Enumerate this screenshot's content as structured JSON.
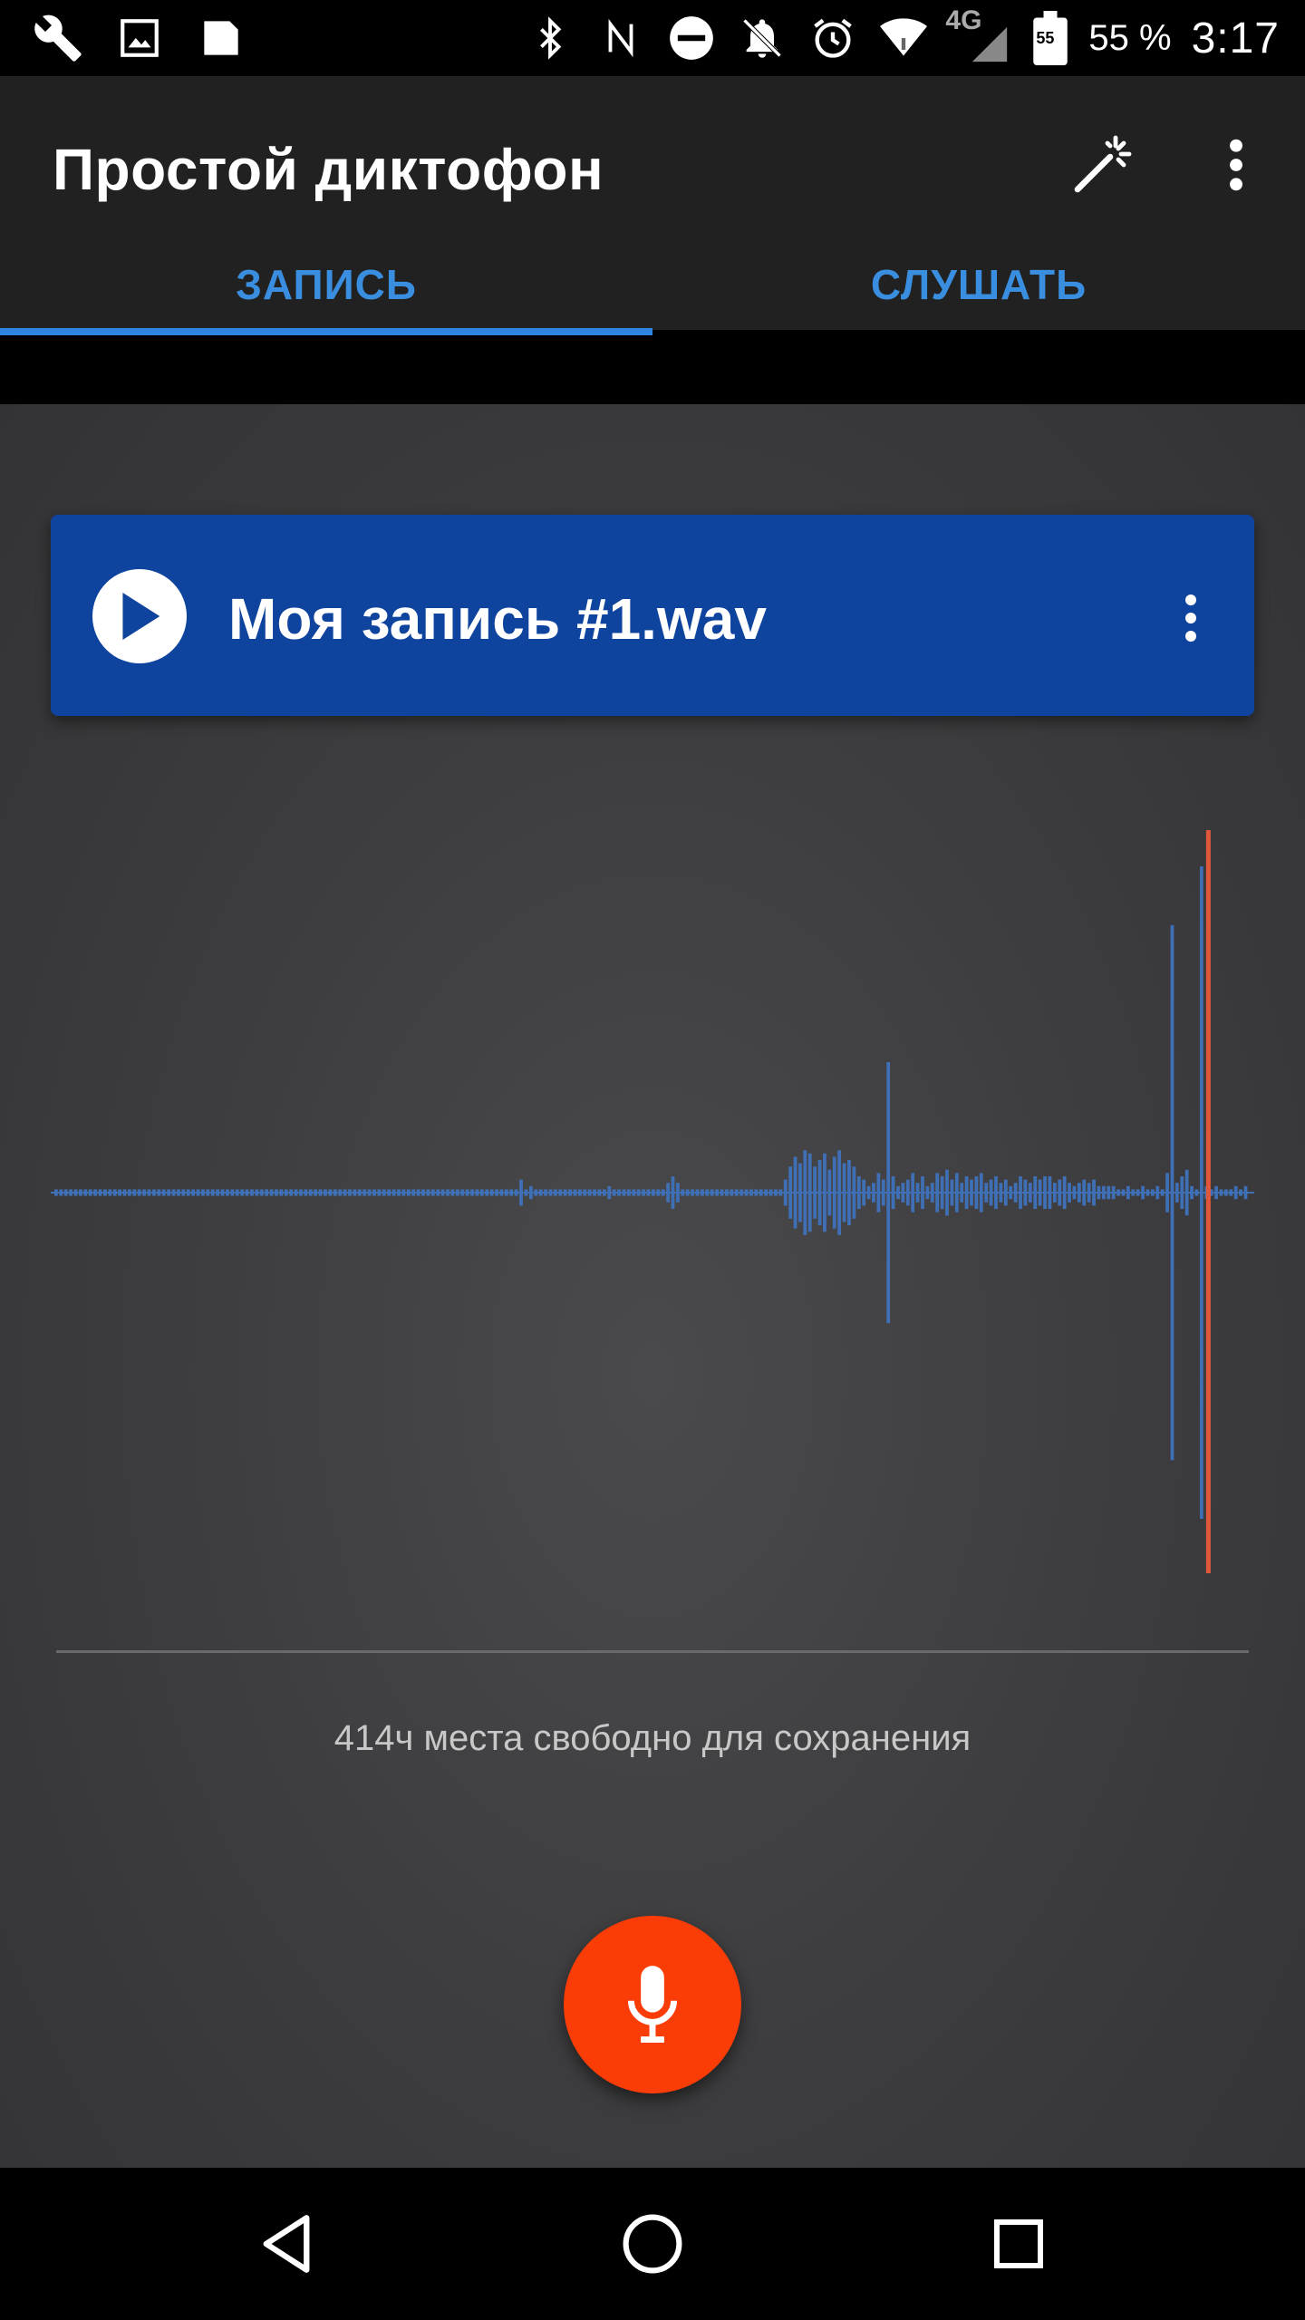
{
  "status_bar": {
    "battery_icon_text": "55",
    "battery_percent": "55 %",
    "network": "4G",
    "time": "3:17",
    "icons_left": [
      "wrench-icon",
      "image-icon",
      "sd-card-icon"
    ],
    "icons_right": [
      "bluetooth-icon",
      "nfc-icon",
      "do-not-disturb-icon",
      "notifications-off-icon",
      "alarm-icon",
      "wifi-icon",
      "signal-icon",
      "battery-icon"
    ]
  },
  "app_bar": {
    "title": "Простой диктофон",
    "actions": [
      "magic-wand-icon",
      "more-vert-icon"
    ]
  },
  "tabs": [
    {
      "label": "ЗАПИСЬ",
      "selected": true
    },
    {
      "label": "СЛУШАТЬ",
      "selected": false
    }
  ],
  "recording": {
    "file_name": "Моя запись #1.wav"
  },
  "storage": {
    "free_text": "414ч места свободно для сохранения"
  },
  "waveform": {
    "amplitudes": [
      0.01,
      0.01,
      0.01,
      0.01,
      0.01,
      0.01,
      0.01,
      0.01,
      0.01,
      0.01,
      0.01,
      0.01,
      0.01,
      0.01,
      0.01,
      0.01,
      0.01,
      0.01,
      0.01,
      0.01,
      0.01,
      0.01,
      0.01,
      0.01,
      0.01,
      0.01,
      0.01,
      0.01,
      0.01,
      0.01,
      0.01,
      0.01,
      0.01,
      0.01,
      0.01,
      0.01,
      0.01,
      0.01,
      0.01,
      0.01,
      0.01,
      0.01,
      0.01,
      0.01,
      0.01,
      0.01,
      0.01,
      0.01,
      0.01,
      0.01,
      0.01,
      0.01,
      0.01,
      0.01,
      0.01,
      0.01,
      0.01,
      0.01,
      0.01,
      0.01,
      0.01,
      0.01,
      0.01,
      0.01,
      0.01,
      0.01,
      0.01,
      0.01,
      0.01,
      0.01,
      0.01,
      0.01,
      0.01,
      0.01,
      0.01,
      0.01,
      0.01,
      0.01,
      0.01,
      0.01,
      0.01,
      0.01,
      0.01,
      0.01,
      0.01,
      0.01,
      0.01,
      0.01,
      0.01,
      0.01,
      0.01,
      0.01,
      0.01,
      0.01,
      0.01,
      0.04,
      0.01,
      0.02,
      0.01,
      0.01,
      0.01,
      0.01,
      0.01,
      0.01,
      0.01,
      0.01,
      0.01,
      0.01,
      0.01,
      0.01,
      0.01,
      0.01,
      0.01,
      0.02,
      0.01,
      0.01,
      0.01,
      0.01,
      0.01,
      0.01,
      0.01,
      0.01,
      0.01,
      0.01,
      0.01,
      0.03,
      0.05,
      0.03,
      0.01,
      0.01,
      0.01,
      0.01,
      0.01,
      0.01,
      0.01,
      0.01,
      0.01,
      0.01,
      0.01,
      0.01,
      0.01,
      0.01,
      0.01,
      0.01,
      0.01,
      0.01,
      0.01,
      0.01,
      0.01,
      0.04,
      0.08,
      0.11,
      0.09,
      0.13,
      0.12,
      0.08,
      0.1,
      0.12,
      0.07,
      0.11,
      0.13,
      0.09,
      0.1,
      0.08,
      0.05,
      0.04,
      0.02,
      0.03,
      0.06,
      0.04,
      0.4,
      0.05,
      0.02,
      0.03,
      0.04,
      0.06,
      0.03,
      0.05,
      0.02,
      0.03,
      0.06,
      0.05,
      0.07,
      0.04,
      0.06,
      0.03,
      0.05,
      0.04,
      0.05,
      0.06,
      0.03,
      0.04,
      0.05,
      0.03,
      0.04,
      0.02,
      0.03,
      0.05,
      0.04,
      0.03,
      0.05,
      0.04,
      0.05,
      0.05,
      0.03,
      0.04,
      0.05,
      0.03,
      0.02,
      0.03,
      0.04,
      0.03,
      0.04,
      0.02,
      0.02,
      0.02,
      0.02,
      0.01,
      0.01,
      0.02,
      0.01,
      0.01,
      0.02,
      0.01,
      0.01,
      0.02,
      0.01,
      0.06,
      0.82,
      0.03,
      0.05,
      0.07,
      0.02,
      0.01,
      1.0,
      0.02,
      0.01,
      0.02,
      0.01,
      0.01,
      0.01,
      0.02,
      0.01,
      0.02
    ],
    "playhead_position": 0.96,
    "wave_color": "#3f6fb5",
    "playhead_color": "#e0573a"
  },
  "colors": {
    "accent": "#2f86e0",
    "card": "#0f449e",
    "record_button": "#fa3d07"
  },
  "nav_bar": {
    "buttons": [
      "back-icon",
      "home-icon",
      "recents-icon"
    ]
  }
}
